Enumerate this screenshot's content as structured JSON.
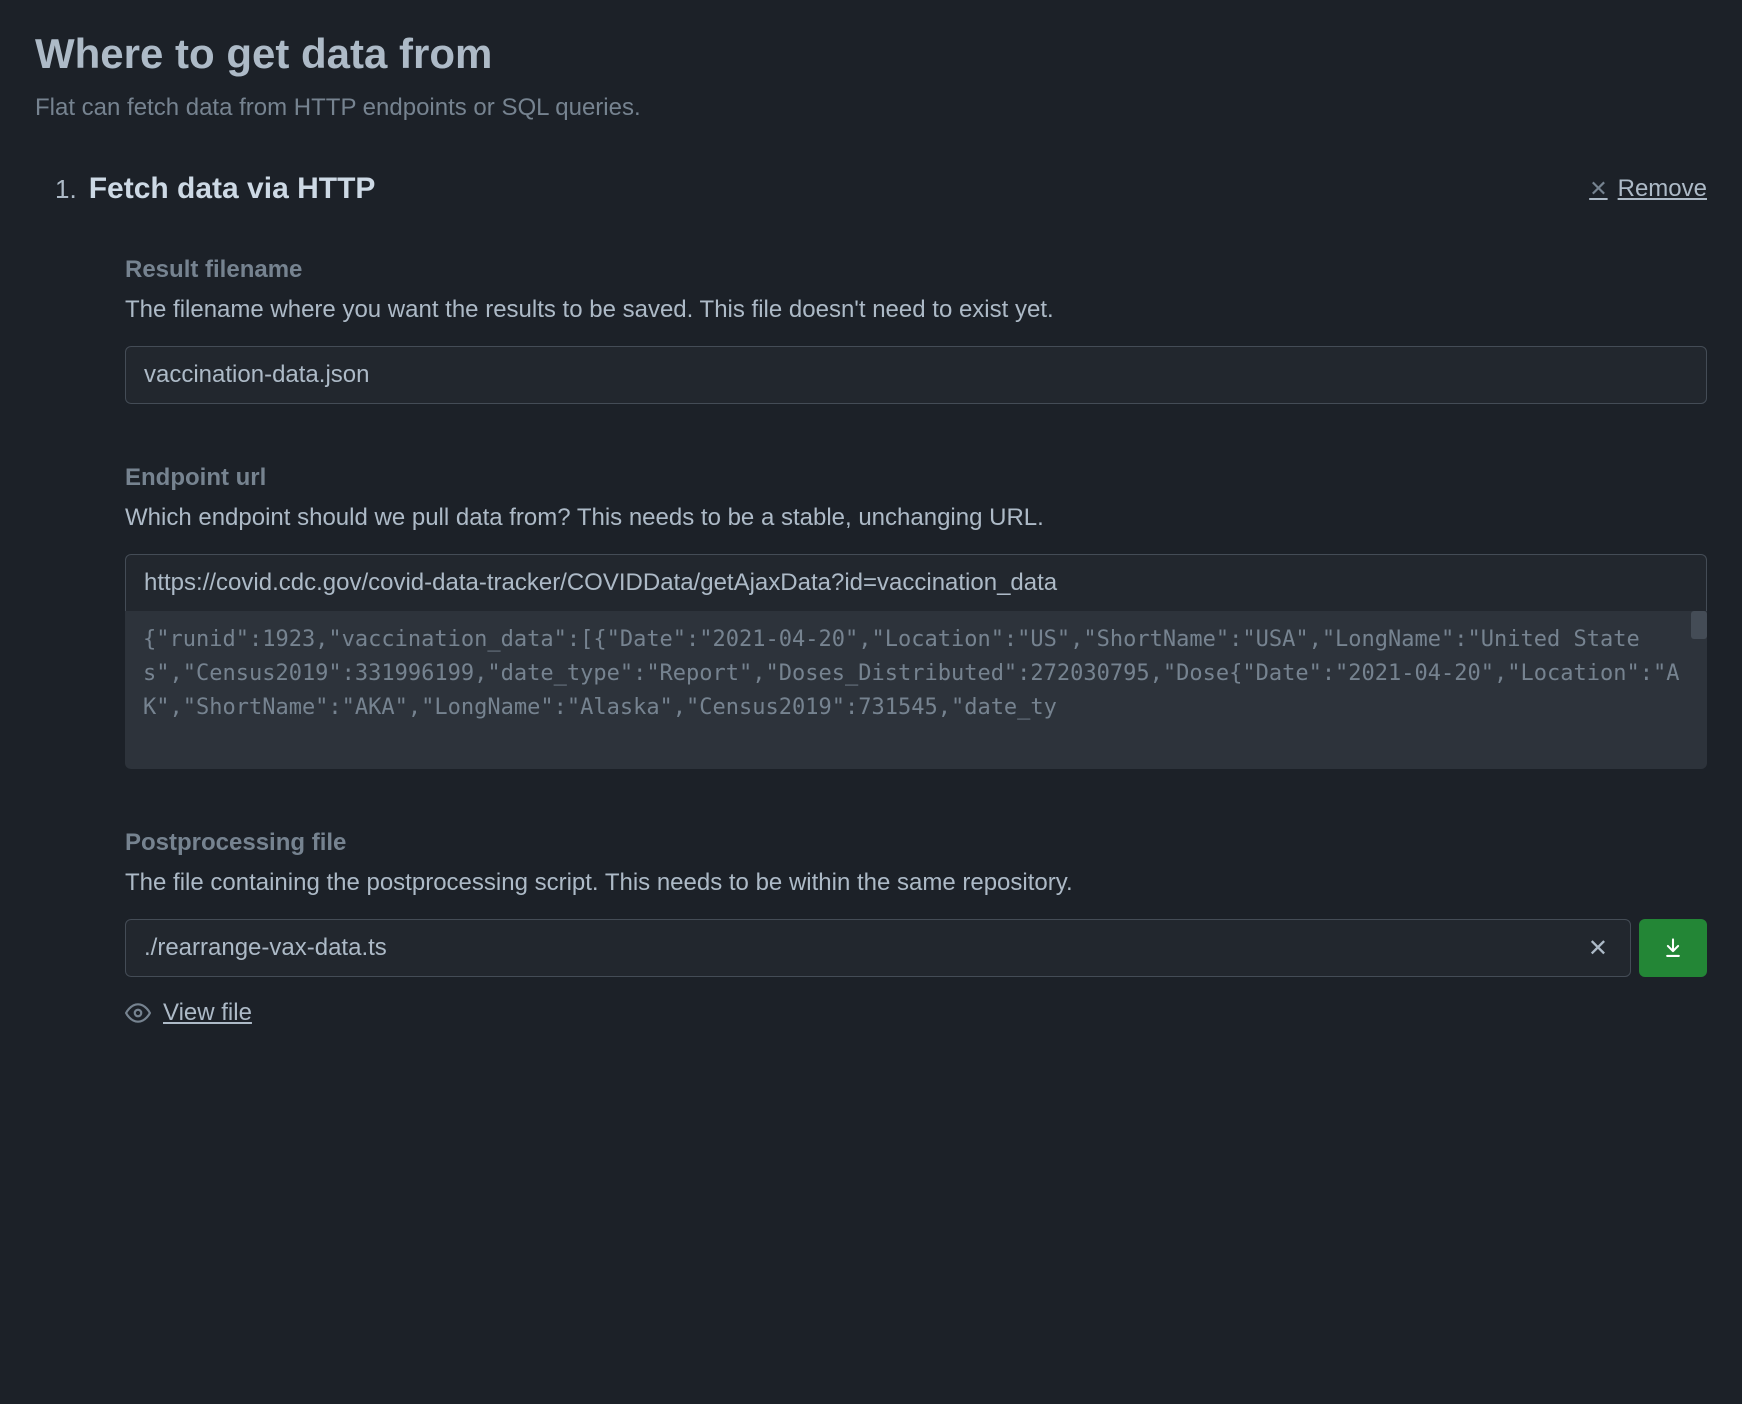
{
  "header": {
    "title": "Where to get data from",
    "subtitle": "Flat can fetch data from HTTP endpoints or SQL queries."
  },
  "step": {
    "number": "1.",
    "title": "Fetch data via HTTP",
    "remove_label": "Remove"
  },
  "result_filename": {
    "label": "Result filename",
    "desc": "The filename where you want the results to be saved. This file doesn't need to exist yet.",
    "value": "vaccination-data.json"
  },
  "endpoint": {
    "label": "Endpoint url",
    "desc": "Which endpoint should we pull data from? This needs to be a stable, unchanging URL.",
    "value": "https://covid.cdc.gov/covid-data-tracker/COVIDData/getAjaxData?id=vaccination_data",
    "preview": "{\"runid\":1923,\"vaccination_data\":[{\"Date\":\"2021-04-20\",\"Location\":\"US\",\"ShortName\":\"USA\",\"LongName\":\"United States\",\"Census2019\":331996199,\"date_type\":\"Report\",\"Doses_Distributed\":272030795,\"Dose{\"Date\":\"2021-04-20\",\"Location\":\"AK\",\"ShortName\":\"AKA\",\"LongName\":\"Alaska\",\"Census2019\":731545,\"date_ty"
  },
  "postprocess": {
    "label": "Postprocessing file",
    "desc": "The file containing the postprocessing script. This needs to be within the same repository.",
    "value": "./rearrange-vax-data.ts",
    "view_file_label": "View file"
  }
}
